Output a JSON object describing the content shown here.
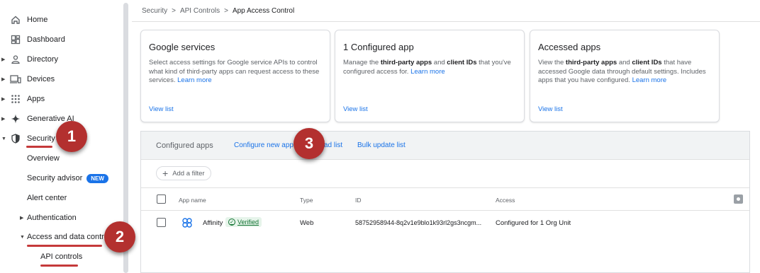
{
  "sidebar": {
    "items": [
      {
        "label": "Home",
        "icon": "home-icon"
      },
      {
        "label": "Dashboard",
        "icon": "dashboard-icon"
      },
      {
        "label": "Directory",
        "icon": "person-icon"
      },
      {
        "label": "Devices",
        "icon": "devices-icon"
      },
      {
        "label": "Apps",
        "icon": "apps-grid-icon"
      },
      {
        "label": "Generative AI",
        "icon": "sparkle-icon"
      },
      {
        "label": "Security",
        "icon": "shield-icon"
      }
    ],
    "security_sub": {
      "overview": "Overview",
      "security_advisor": "Security advisor",
      "new_badge": "NEW",
      "alert_center": "Alert center",
      "authentication": "Authentication",
      "access_data_control": "Access and data control",
      "api_controls": "API controls"
    }
  },
  "annotations": {
    "step1": "1",
    "step2": "2",
    "step3": "3",
    "color": "#b3302f"
  },
  "breadcrumb": {
    "items": [
      "Security",
      "API Controls",
      "App Access Control"
    ],
    "separator": ">"
  },
  "cards": [
    {
      "title": "Google services",
      "desc_text": "Select access settings for Google service APIs to control what kind of third-party apps can request access to these services.",
      "learn_more": "Learn more",
      "view_list": "View list"
    },
    {
      "title": "1 Configured app",
      "desc_pre": "Manage the",
      "desc_b1": "third-party apps",
      "desc_mid": "and",
      "desc_b2": "client IDs",
      "desc_post": "that you've configured access for.",
      "learn_more": "Learn more",
      "view_list": "View list"
    },
    {
      "title": "Accessed apps",
      "desc_pre": "View the",
      "desc_b1": "third-party apps",
      "desc_mid": "and",
      "desc_b2": "client IDs",
      "desc_post": "that have accessed Google data through default settings. Includes apps that you have configured.",
      "learn_more": "Learn more",
      "view_list": "View list"
    }
  ],
  "panel": {
    "title": "Configured apps",
    "tab_configure": "Configure new app",
    "tab_download": "ad list",
    "tab_bulk": "Bulk update list",
    "filter": "Add a filter",
    "columns": {
      "name": "App name",
      "type": "Type",
      "id": "ID",
      "access": "Access"
    },
    "rows": [
      {
        "name": "Affinity",
        "verified": "Verified",
        "type": "Web",
        "id": "58752958944-8q2v1e9blo1k93rl2gs3ncgm...",
        "access": "Configured for 1 Org Unit"
      }
    ]
  }
}
